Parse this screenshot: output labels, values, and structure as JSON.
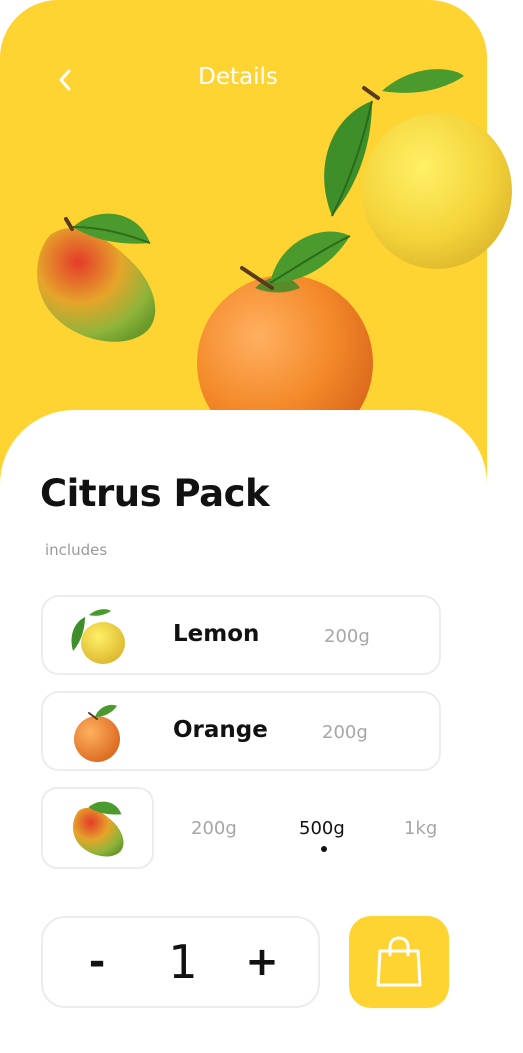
{
  "header": {
    "title": "Details",
    "back_icon": "chevron-left-icon"
  },
  "colors": {
    "accent": "#FFD332",
    "card_border": "#ECECEC",
    "muted_text": "#A6A6A6",
    "primary_text": "#111111"
  },
  "hero": {
    "fruits": [
      "lemon",
      "mango",
      "orange"
    ]
  },
  "product": {
    "title": "Citrus Pack",
    "includes_label": "includes"
  },
  "items": [
    {
      "name": "Lemon",
      "weight": "200g",
      "icon": "lemon-icon"
    },
    {
      "name": "Orange",
      "weight": "200g",
      "icon": "orange-icon"
    }
  ],
  "weight_selector": {
    "icon": "mango-icon",
    "options": [
      "200g",
      "500g",
      "1kg"
    ],
    "selected": "500g"
  },
  "quantity": {
    "minus_label": "-",
    "value": "1",
    "plus_label": "+"
  },
  "cart_button": {
    "icon": "shopping-bag-icon"
  }
}
